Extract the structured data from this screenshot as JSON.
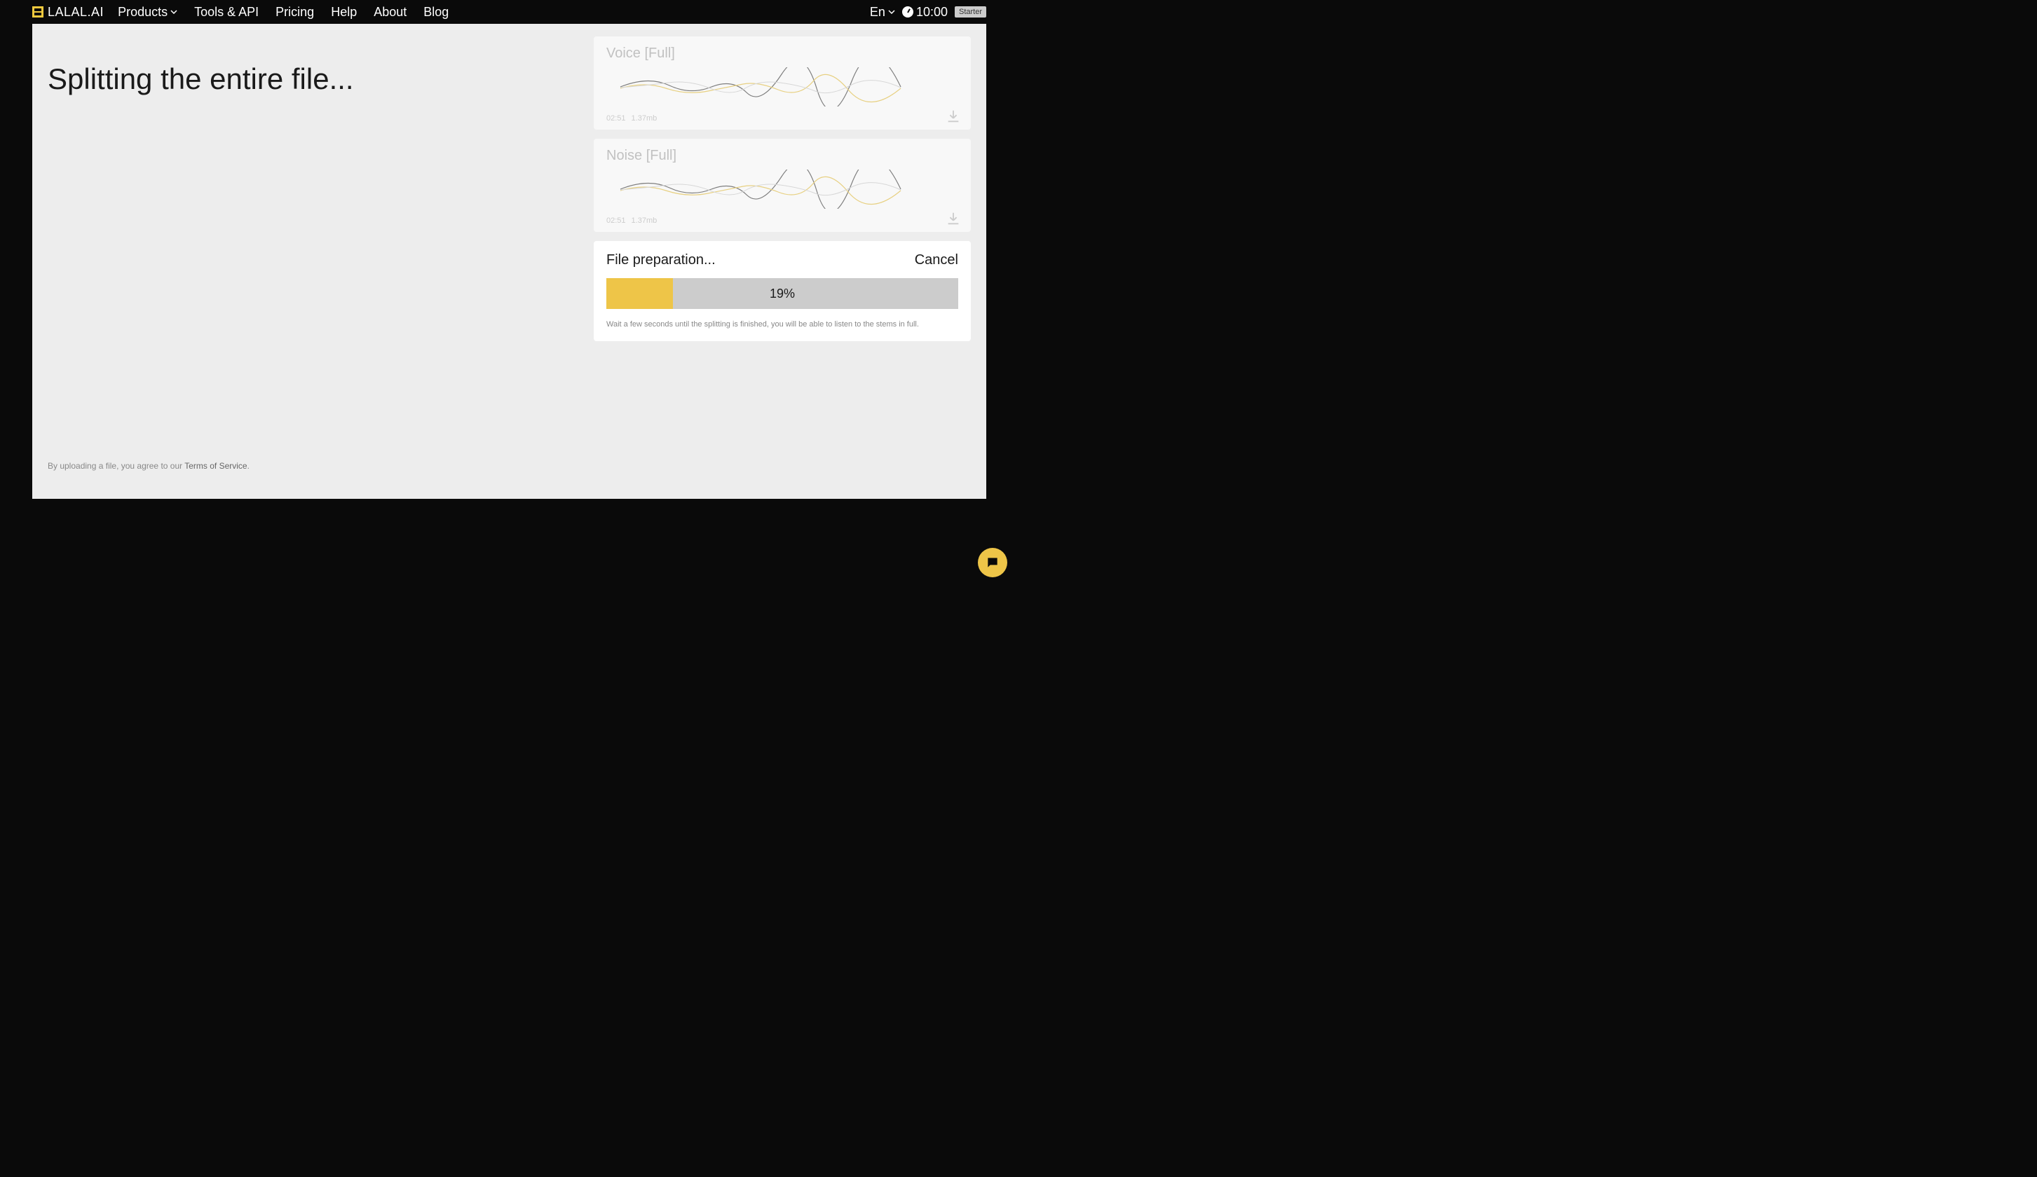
{
  "header": {
    "logo": "LALAL.AI",
    "nav": {
      "products": "Products",
      "tools_api": "Tools & API",
      "pricing": "Pricing",
      "help": "Help",
      "about": "About",
      "blog": "Blog"
    },
    "lang": "En",
    "time": "10:00",
    "plan_badge": "Starter"
  },
  "main": {
    "title": "Splitting the entire file...",
    "terms_prefix": "By uploading a file, you agree to our ",
    "terms_link": "Terms of Service",
    "terms_suffix": "."
  },
  "tracks": [
    {
      "title": "Voice [Full]",
      "duration": "02:51",
      "size": "1.37mb"
    },
    {
      "title": "Noise [Full]",
      "duration": "02:51",
      "size": "1.37mb"
    }
  ],
  "progress": {
    "title": "File preparation...",
    "cancel": "Cancel",
    "percent_value": 19,
    "percent_label": "19%",
    "hint": "Wait a few seconds until the splitting is finished, you will be able to listen to the stems in full."
  },
  "colors": {
    "accent": "#eec548",
    "bg_dark": "#0a0a0a",
    "panel": "#ededed"
  }
}
